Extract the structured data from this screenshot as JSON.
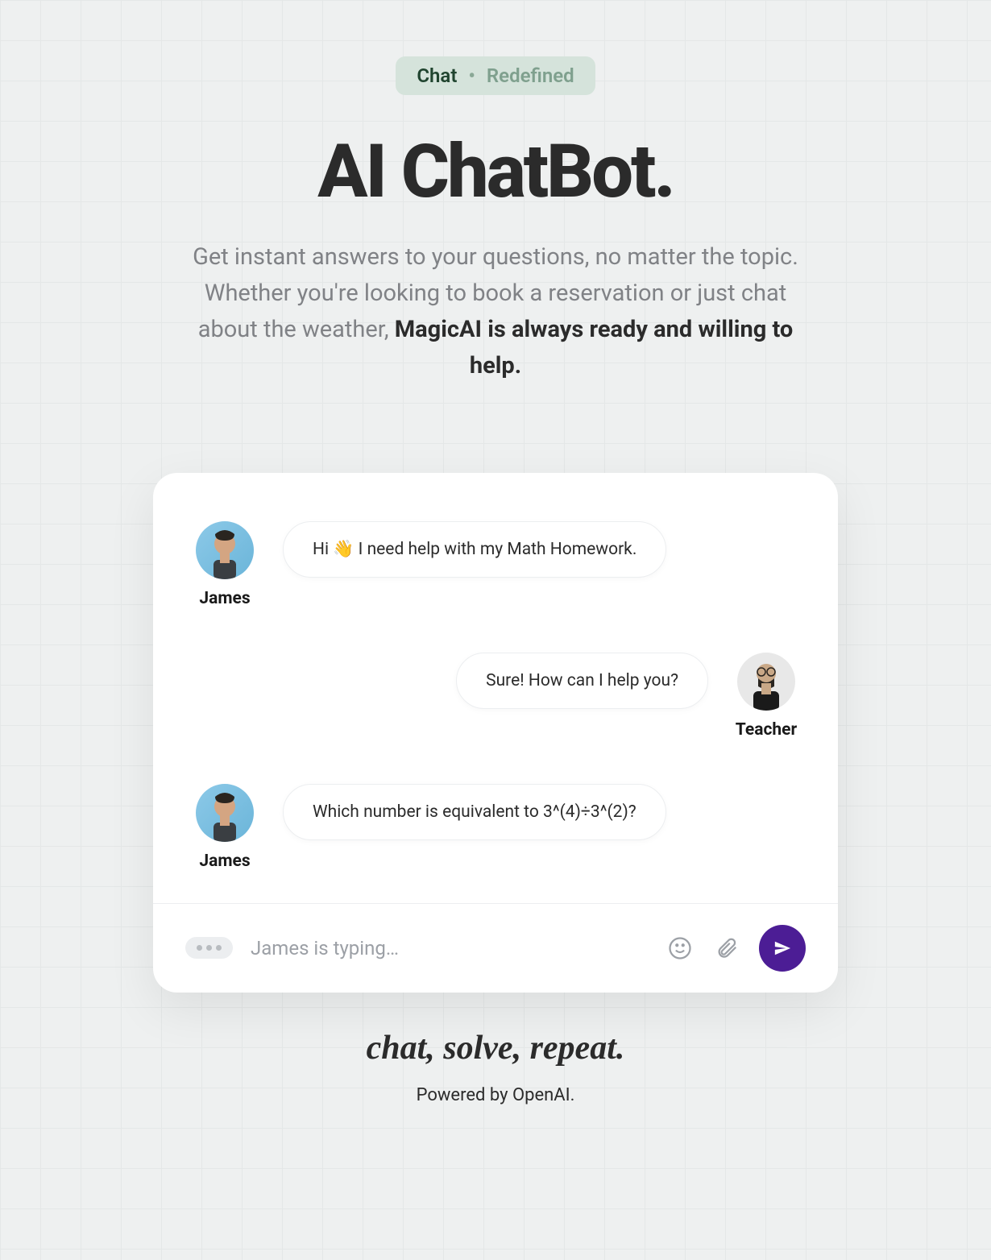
{
  "badge": {
    "chat": "Chat",
    "dot": "•",
    "redefined": "Redefined"
  },
  "title": "AI ChatBot.",
  "subtitle_1": "Get instant answers to your questions, no matter the topic. Whether you're looking to book a reservation or just chat about the weather, ",
  "subtitle_2": "MagicAI is always ready and willing to help.",
  "messages": [
    {
      "name": "James",
      "text": "Hi 👋  I need help with my Math Homework.",
      "side": "left"
    },
    {
      "name": "Teacher",
      "text": "Sure! How can I help you?",
      "side": "right"
    },
    {
      "name": "James",
      "text": "Which number is equivalent to 3^(4)÷3^(2)?",
      "side": "left"
    }
  ],
  "typing": "James is typing…",
  "tagline": "chat, solve, repeat.",
  "powered": "Powered by OpenAI."
}
